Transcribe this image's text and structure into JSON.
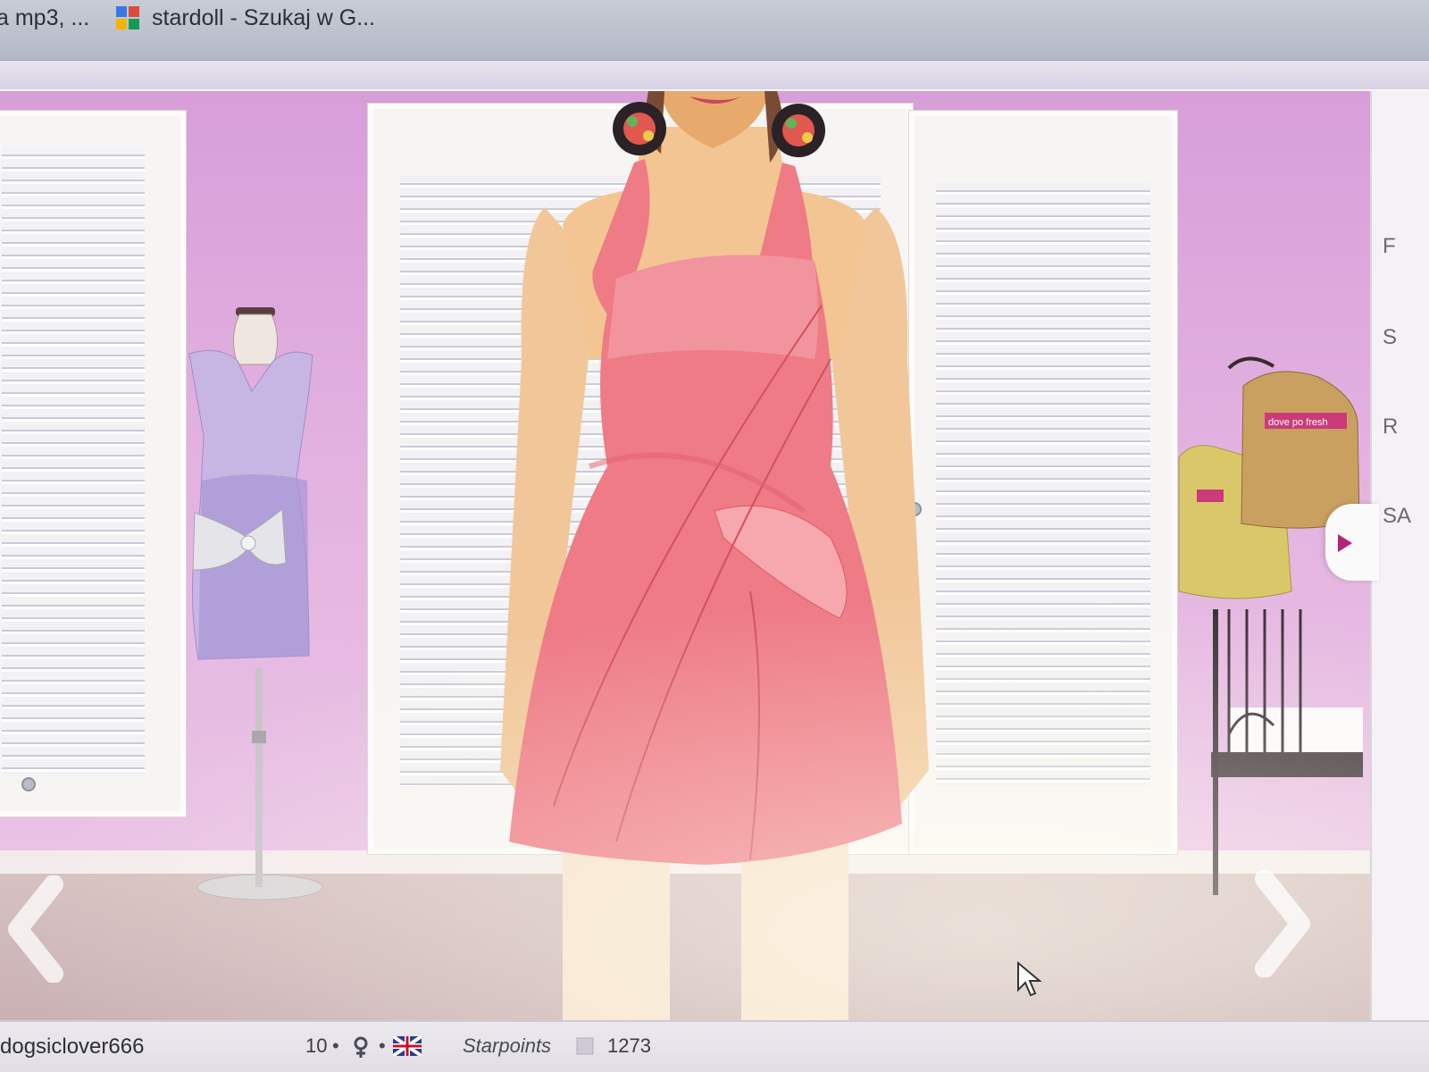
{
  "browser": {
    "tabs": [
      {
        "label": "a mp3, ..."
      },
      {
        "label": "stardoll - Szukaj w G...",
        "icon": "google-search-favicon"
      }
    ]
  },
  "scene": {
    "backpack_label": "dove po fresh"
  },
  "right_panel": {
    "letters": [
      "F",
      "S",
      "R",
      "SA"
    ]
  },
  "statusbar": {
    "username": "dogsiclover666",
    "level": "10",
    "gender_icon": "female-icon",
    "flag_icon": "uk-flag-icon",
    "starpoints_label": "Starpoints",
    "starpoints_value": "1273"
  },
  "colors": {
    "wall": "#d79ed9",
    "dress": "#ee7b86",
    "mannequin_dress": "#b9a8da",
    "floor": "#d0b9bb"
  }
}
